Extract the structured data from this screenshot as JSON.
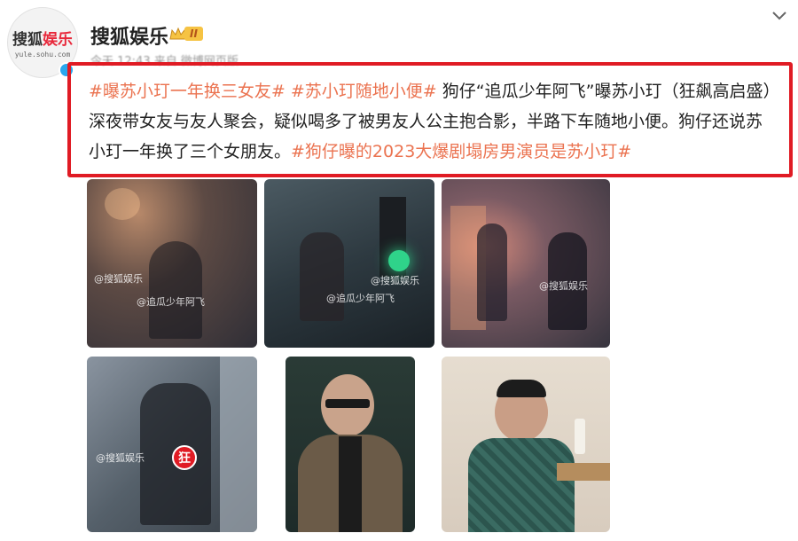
{
  "account": {
    "avatar_logo_a": "搜狐",
    "avatar_logo_b": "娱乐",
    "avatar_domain": "yule.sohu.com",
    "name": "搜狐娱乐",
    "level": "II",
    "meta": "今天 12:43 来自 微博网页版"
  },
  "post": {
    "segments": [
      {
        "text": "#曝苏小玎一年换三女友#",
        "tag": true
      },
      {
        "text": " ",
        "tag": false
      },
      {
        "text": "#苏小玎随地小便#",
        "tag": true
      },
      {
        "text": " 狗仔“追瓜少年阿飞”曝苏小玎（狂飙高启盛）深夜带女友与友人聚会，疑似喝多了被男友人公主抱合影，半路下车随地小便。狗仔还说苏小玎一年换了三个女朋友。",
        "tag": false
      },
      {
        "text": "#狗仔曝的2023大爆剧塌房男演员是苏小玎#",
        "tag": true
      }
    ]
  },
  "photos": {
    "p1_wm1": "@搜狐娱乐",
    "p1_wm2": "@追瓜少年阿飞",
    "p2_wm1": "@搜狐娱乐",
    "p2_wm2": "@追瓜少年阿飞",
    "p3_wm1": "@搜狐娱乐",
    "p4_wm1": "@搜狐娱乐",
    "p4_circle": "狂"
  },
  "colors": {
    "tag": "#eb7350",
    "highlight_border": "#e01b24",
    "verified": "#2aa7ee"
  },
  "icons": [
    "crown-icon",
    "chevron-down-icon",
    "verified-icon"
  ]
}
